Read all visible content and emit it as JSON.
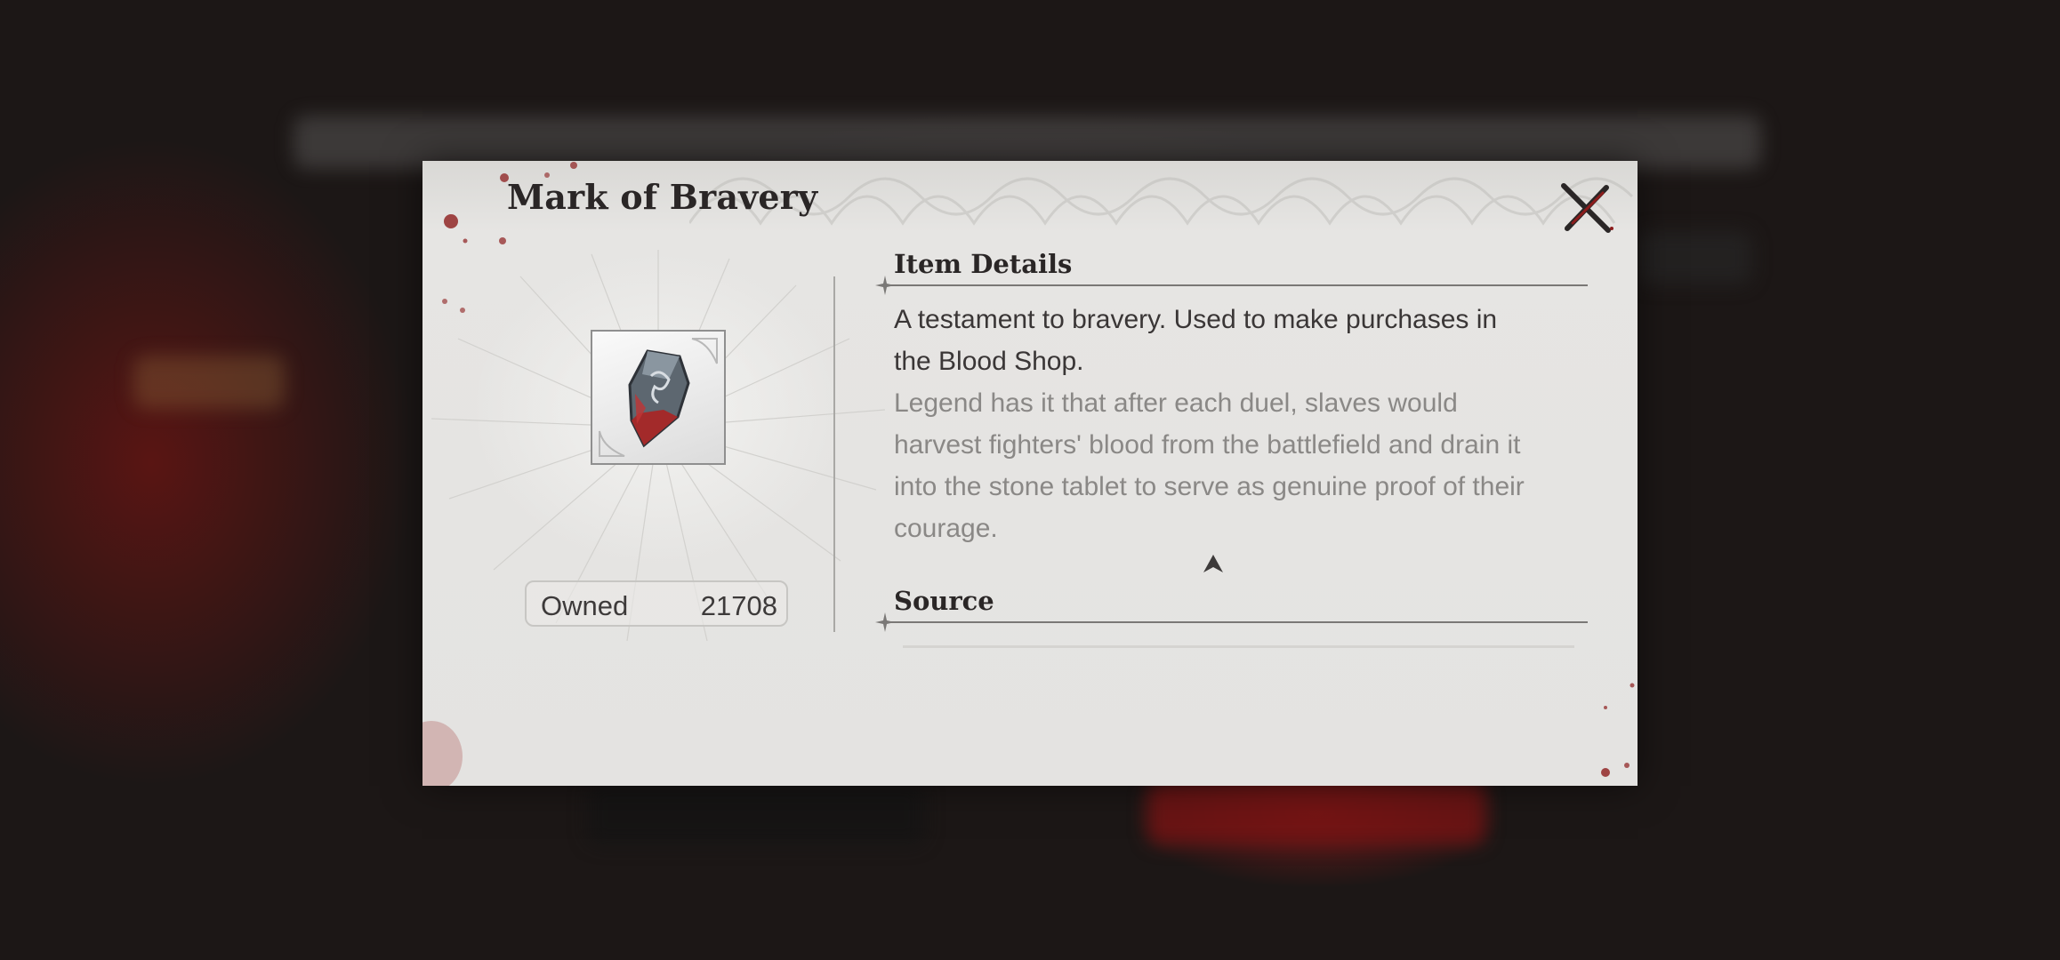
{
  "dialog": {
    "title": "Mark of Bravery",
    "close_icon": "close-x-icon"
  },
  "item": {
    "icon": "blood-stone-shard-icon",
    "owned_label": "Owned",
    "owned_value": "21708"
  },
  "details": {
    "heading": "Item Details",
    "description": "A testament to bravery. Used to make purchases in the Blood Shop.",
    "lore": "Legend has it that after each duel, slaves would harvest fighters' blood from the battlefield and drain it into the stone tablet to serve as genuine proof of their courage.",
    "scroll_icon": "scroll-up-arrow-icon"
  },
  "source": {
    "heading": "Source"
  },
  "colors": {
    "accent_blood": "#8c1c1c",
    "text_dark": "#2a2626",
    "text_muted": "#8a8886",
    "panel": "#e4e3e1"
  }
}
